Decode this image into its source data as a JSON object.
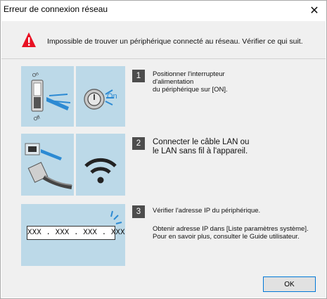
{
  "window": {
    "title": "Erreur de connexion réseau",
    "close_glyph": "✕"
  },
  "header": {
    "icon": "warning-icon",
    "message": "Impossible de trouver un périphérique connecté au réseau. Vérifier ce qui suit."
  },
  "steps": [
    {
      "number": "1",
      "lines": [
        "Positionner l'interrupteur",
        "d'alimentation",
        "du périphérique sur [ON]."
      ],
      "images": [
        "power-switch-icon",
        "power-button-on-icon"
      ],
      "labels": {
        "switch_on": "On",
        "switch_off": "Off",
        "button_on": "On"
      }
    },
    {
      "number": "2",
      "lines": [
        "Connecter le câble LAN ou",
        "le LAN sans fil à l'appareil."
      ],
      "images": [
        "lan-cable-icon",
        "wifi-icon"
      ]
    },
    {
      "number": "3",
      "line1": "Vérifier l'adresse IP du périphérique.",
      "line2": "Obtenir adresse IP dans [Liste paramètres système].",
      "line3": "Pour en savoir plus, consulter le Guide utilisateur.",
      "ip_placeholder": "XXX . XXX . XXX . XXX"
    }
  ],
  "buttons": {
    "ok": "OK"
  },
  "colors": {
    "panel": "#bcd9e8",
    "accent": "#0078d7",
    "warning": "#e81123",
    "step_badge": "#4d4d4d"
  }
}
